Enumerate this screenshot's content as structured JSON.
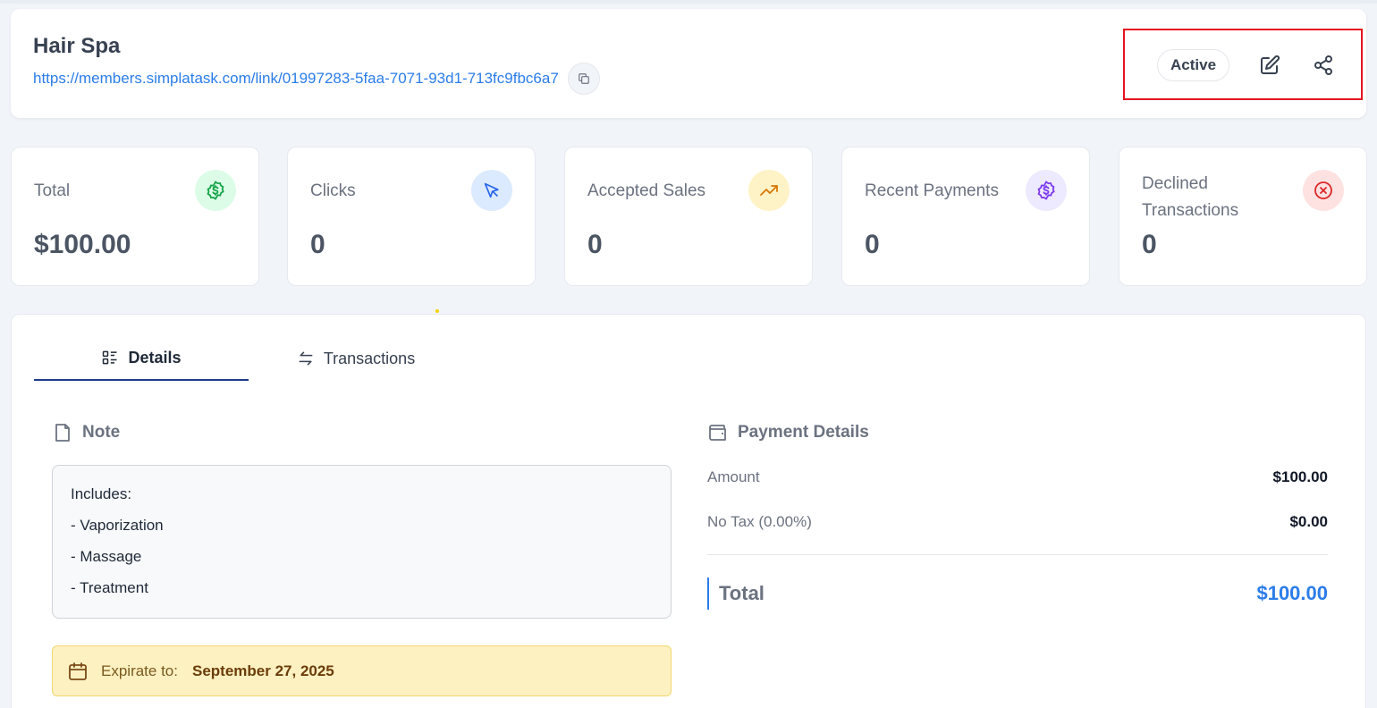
{
  "header": {
    "title": "Hair Spa",
    "link_url": "https://members.simplatask.com/link/01997283-5faa-7071-93d1-713fc9fbc6a7",
    "status": "Active",
    "icons": {
      "copy": "copy-icon",
      "edit": "edit-icon",
      "share": "share-icon"
    }
  },
  "stats": [
    {
      "label": "Total",
      "value": "$100.00",
      "icon": "dollar-badge-icon",
      "color": "#16a34a",
      "bg": "#dcfce7"
    },
    {
      "label": "Clicks",
      "value": "0",
      "icon": "cursor-click-icon",
      "color": "#2563eb",
      "bg": "#dbeafe"
    },
    {
      "label": "Accepted Sales",
      "value": "0",
      "icon": "trending-up-icon",
      "color": "#d97706",
      "bg": "#fef3c7"
    },
    {
      "label": "Recent Payments",
      "value": "0",
      "icon": "dollar-badge-icon",
      "color": "#7c3aed",
      "bg": "#ede9fe"
    },
    {
      "label": "Declined Transactions",
      "value": "0",
      "icon": "x-circle-icon",
      "color": "#dc2626",
      "bg": "#fee2e2"
    }
  ],
  "tabs": [
    {
      "label": "Details",
      "icon": "list-details-icon",
      "active": true
    },
    {
      "label": "Transactions",
      "icon": "arrows-exchange-icon",
      "active": false
    }
  ],
  "note": {
    "title": "Note",
    "lines": [
      "Includes:",
      "- Vaporization",
      "- Massage",
      "- Treatment"
    ]
  },
  "expiration": {
    "label": "Expirate to:",
    "date": "September 27, 2025"
  },
  "payment": {
    "title": "Payment Details",
    "rows": [
      {
        "label": "Amount",
        "value": "$100.00"
      },
      {
        "label": "No Tax (0.00%)",
        "value": "$0.00"
      }
    ],
    "total_label": "Total",
    "total_value": "$100.00"
  },
  "colors": {
    "accent": "#2b7de9",
    "highlight_border": "#e5141f",
    "tab_active": "#1e3a8a"
  }
}
